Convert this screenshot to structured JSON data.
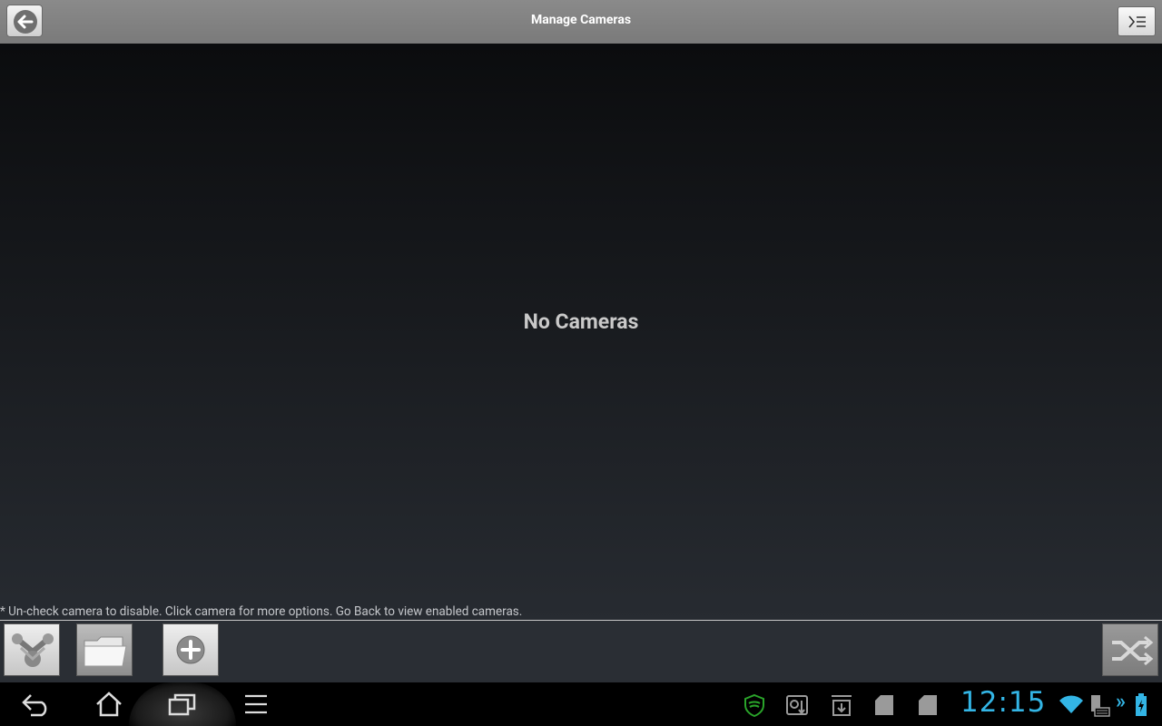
{
  "title_bar": {
    "title": "Manage Cameras",
    "back_icon": "arrow-left-icon",
    "menu_icon": "menu-list-icon"
  },
  "content": {
    "empty_message": "No Cameras",
    "hint": "* Un-check camera to disable. Click camera for more options. Go Back to view enabled cameras."
  },
  "toolbar": {
    "buttons": [
      {
        "name": "network-discover-button",
        "icon": "network-scan-icon"
      },
      {
        "name": "open-folder-button",
        "icon": "folder-icon"
      },
      {
        "name": "add-camera-button",
        "icon": "plus-circle-icon"
      },
      {
        "name": "shuffle-button",
        "icon": "shuffle-icon"
      }
    ]
  },
  "system_bar": {
    "nav": [
      "back-icon",
      "home-icon",
      "recent-apps-icon",
      "menu-icon"
    ],
    "clock": "12:15",
    "status_icons": [
      "shield-icon",
      "usb-debug-icon",
      "download-icon",
      "sd-card-icon",
      "sd-card-icon",
      "wifi-icon",
      "keyboard-icon",
      "battery-icon"
    ],
    "colors": {
      "accent": "#33b5e5",
      "shield": "#2aa42a"
    }
  }
}
